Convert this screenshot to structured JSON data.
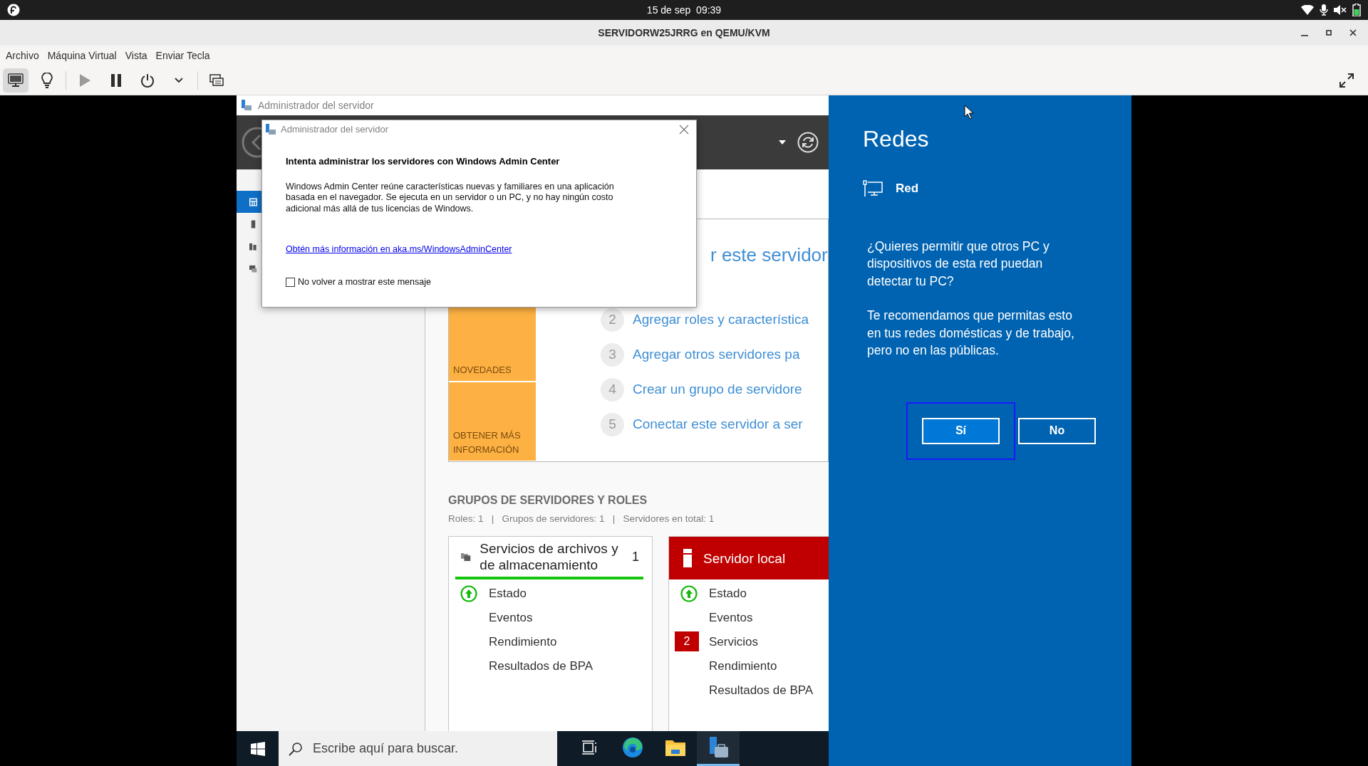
{
  "top_bar": {
    "clock": "15 de sep  09:39"
  },
  "window": {
    "title": "SERVIDORW25JRRG en QEMU/KVM"
  },
  "menu": [
    "Archivo",
    "Máquina Virtual",
    "Vista",
    "Enviar Tecla"
  ],
  "toolbar": [
    {
      "kind": "console",
      "selected": true,
      "disabled": false
    },
    {
      "kind": "details",
      "selected": false,
      "disabled": false
    },
    {
      "kind": "run",
      "selected": false,
      "disabled": true
    },
    {
      "kind": "pause",
      "selected": false,
      "disabled": false
    },
    {
      "kind": "shutdown",
      "selected": false,
      "disabled": false
    },
    {
      "kind": "menu",
      "selected": false,
      "disabled": false
    },
    {
      "kind": "screens",
      "selected": false,
      "disabled": false
    }
  ],
  "server_manager": {
    "title": "Administrador del servidor",
    "nav": [
      {
        "kind": "dashboard",
        "selected": true
      },
      {
        "kind": "server",
        "selected": false
      },
      {
        "kind": "servers",
        "selected": false
      },
      {
        "kind": "roles",
        "selected": false
      }
    ],
    "welcome": {
      "heading": "r este servidor",
      "tiles": [
        "NOVEDADES",
        "OBTENER MÁS INFORMACIÓN"
      ],
      "steps": [
        {
          "number": "2",
          "text": "Agregar roles y característica"
        },
        {
          "number": "3",
          "text": "Agregar otros servidores pa"
        },
        {
          "number": "4",
          "text": "Crear un grupo de servidore"
        },
        {
          "number": "5",
          "text": "Conectar este servidor a ser"
        }
      ]
    },
    "groups": {
      "title": "GRUPOS DE SERVIDORES Y ROLES",
      "summary": "Roles: 1   |   Grupos de servidores: 1   |   Servidores en total: 1",
      "tiles": [
        {
          "title": "Servicios de archivos y de almacenamiento",
          "count": "1",
          "kind": "ok",
          "rows": [
            {
              "label": "Estado",
              "kind": "status"
            },
            {
              "label": "Eventos",
              "kind": "plain"
            },
            {
              "label": "Rendimiento",
              "kind": "plain"
            },
            {
              "label": "Resultados de BPA",
              "kind": "plain"
            }
          ]
        },
        {
          "title": "Servidor local",
          "kind": "alert",
          "rows": [
            {
              "label": "Estado",
              "kind": "status"
            },
            {
              "label": "Eventos",
              "kind": "plain"
            },
            {
              "label": "Servicios",
              "kind": "count",
              "count": "2"
            },
            {
              "label": "Rendimiento",
              "kind": "plain"
            },
            {
              "label": "Resultados de BPA",
              "kind": "plain"
            }
          ]
        }
      ]
    }
  },
  "dialog": {
    "title": "Administrador del servidor",
    "heading": "Intenta administrar los servidores con Windows Admin Center",
    "body": "Windows Admin Center reúne características nuevas y familiares en una aplicación basada en el navegador. Se ejecuta en un servidor o un PC, y no hay ningún costo adicional más allá de tus licencias de Windows.",
    "link": "Obtén más información en aka.ms/WindowsAdminCenter",
    "checkbox": {
      "label": "No volver a mostrar este mensaje",
      "checked": false
    }
  },
  "taskbar": {
    "search_placeholder": "Escribe aquí para buscar.",
    "apps": [
      {
        "kind": "task-view",
        "active": false
      },
      {
        "kind": "browser",
        "active": false
      },
      {
        "kind": "folder",
        "active": false
      },
      {
        "kind": "server-manager",
        "active": true
      }
    ]
  },
  "network_panel": {
    "title": "Redes",
    "network": "Red",
    "question": "¿Quieres permitir que otros PC y\ndispositivos de esta red puedan\ndetectar tu PC?",
    "advice": "Te recomendamos que permitas esto\nen tus redes domésticas y de trabajo,\npero no en las públicas.",
    "buttons": [
      {
        "label": "Sí",
        "focused": true
      },
      {
        "label": "No",
        "focused": false
      }
    ]
  }
}
